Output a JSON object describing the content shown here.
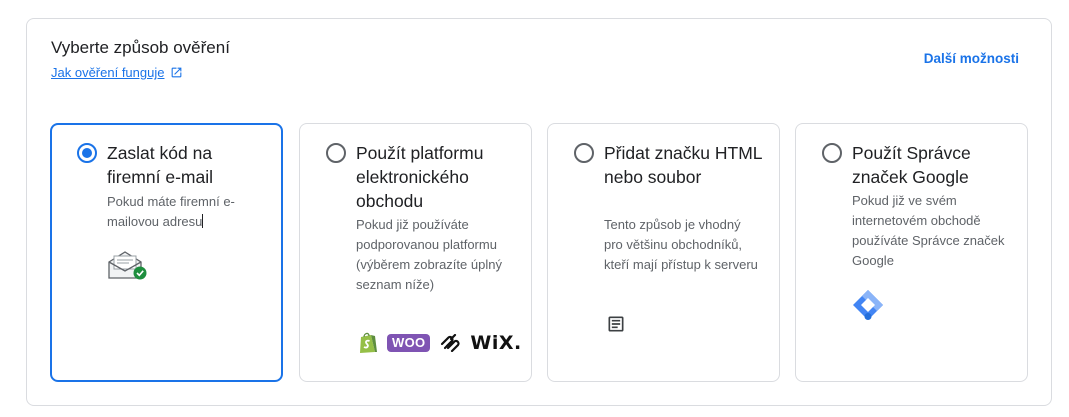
{
  "header": {
    "title": "Vyberte způsob ověření",
    "help_link": "Jak ověření funguje",
    "more_options": "Další možnosti"
  },
  "cards": [
    {
      "title": "Zaslat kód na firemní e-mail",
      "description": "Pokud máte firemní e-mailovou adresu",
      "selected": true,
      "icon": "email-verified-icon"
    },
    {
      "title": "Použít platformu elektronického obchodu",
      "description": "Pokud již používáte podporovanou platformu (výběrem zobrazíte úplný seznam níže)",
      "selected": false,
      "logos": {
        "shopify": "shopify-logo",
        "woo": "WOO",
        "squarespace": "squarespace-logo",
        "wix": "WiX."
      }
    },
    {
      "title": "Přidat značku HTML nebo soubor",
      "description": "Tento způsob je vhodný pro většinu obchodníků, kteří mají přístup k serveru",
      "selected": false,
      "icon": "document-icon"
    },
    {
      "title": "Použít Správce značek Google",
      "description": "Pokud již ve svém internetovém obchodě používáte Správce značek Google",
      "selected": false,
      "icon": "google-tag-manager-icon"
    }
  ],
  "colors": {
    "accent": "#1a73e8",
    "border": "#dadce0",
    "secondary_text": "#5f6368",
    "check_green": "#1e8e3e",
    "woo_purple": "#7f54b3",
    "shopify_green": "#95bf47"
  }
}
